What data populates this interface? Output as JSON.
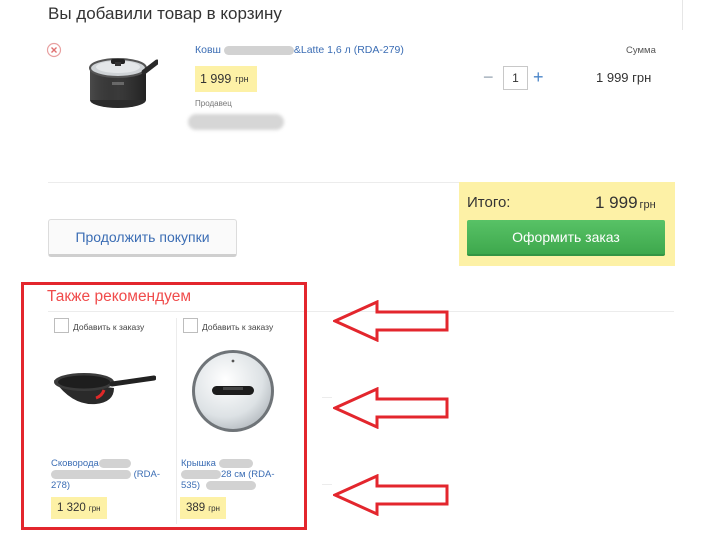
{
  "cart": {
    "title": "Вы добавили товар в корзину",
    "item": {
      "name_start": "Ковш ",
      "name_end": "&Latte 1,6 л (RDA-279)",
      "price": "1 999",
      "currency": "грн",
      "seller_label": "Продавец",
      "quantity": "1",
      "sum_label": "Сумма",
      "sum_value": "1 999 грн"
    },
    "continue_label": "Продолжить покупки"
  },
  "total": {
    "label": "Итого:",
    "value": "1 999",
    "currency": "грн",
    "checkout_label": "Оформить заказ"
  },
  "recommended": {
    "title": "Также рекомендуем",
    "cards": [
      {
        "add_label": "Добавить к заказу",
        "name_start": "Сковорода",
        "name_mid": " (RDA-",
        "name_end": "278)",
        "price": "1 320",
        "currency": "грн"
      },
      {
        "add_label": "Добавить к заказу",
        "name_start": "Крышка ",
        "name_mid": "28 см (RDA-",
        "name_end": "535)",
        "price": "389",
        "currency": "грн"
      }
    ]
  },
  "colors": {
    "link": "#3b6db4",
    "price_badge": "#fdf1a6",
    "checkout_green": "#45ad52",
    "highlight_red": "#e3262d"
  }
}
